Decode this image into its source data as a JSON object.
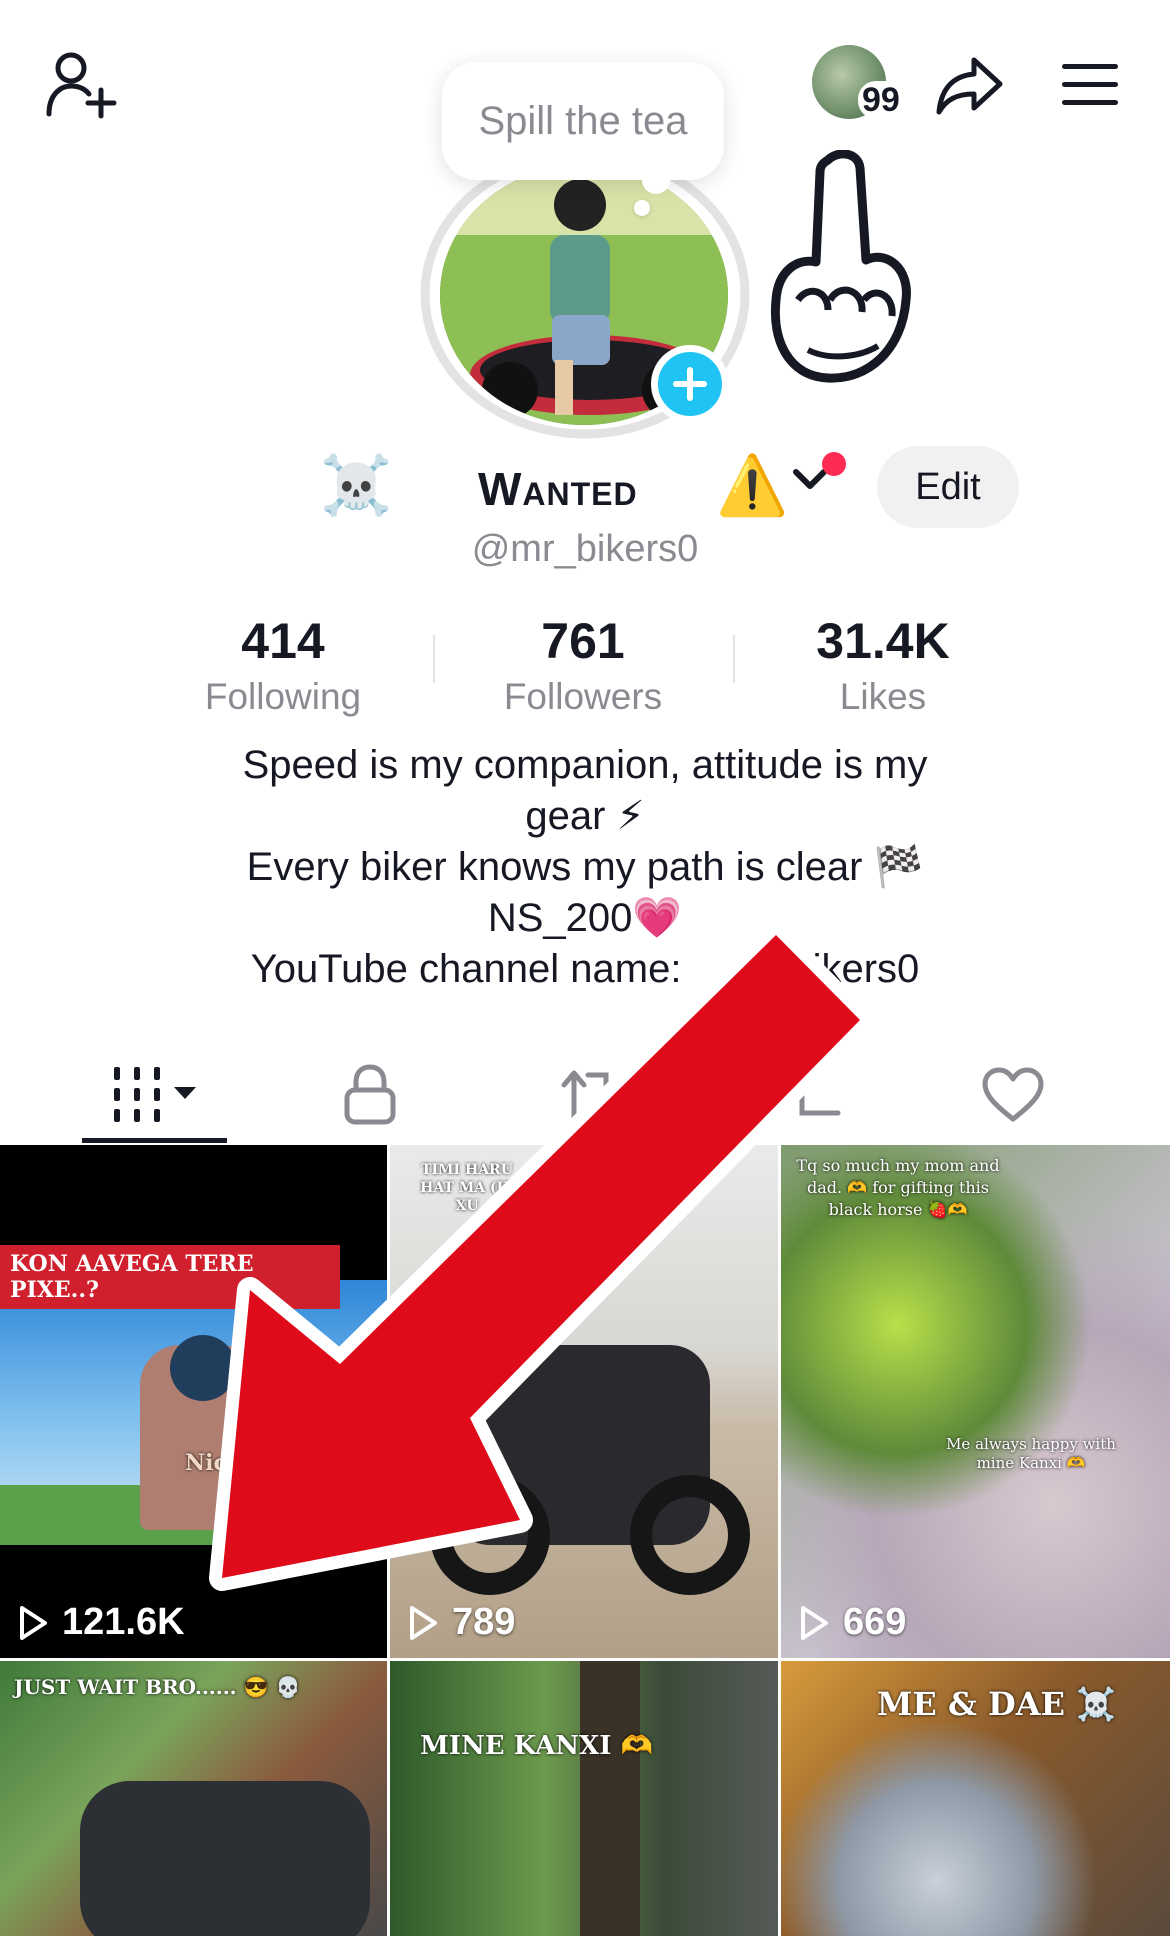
{
  "header": {
    "add_friend_icon": "person-plus-icon",
    "share_icon": "share-arrow-icon",
    "menu_icon": "hamburger-menu-icon",
    "notification_count": "99"
  },
  "bubble": {
    "text": "Spill the tea"
  },
  "profile": {
    "skull_emoji": "☠️",
    "name": "Wanted",
    "warning_emoji": "⚠️",
    "handle": "@mr_bikers0",
    "edit_label": "Edit"
  },
  "stats": [
    {
      "value": "414",
      "label": "Following"
    },
    {
      "value": "761",
      "label": "Followers"
    },
    {
      "value": "31.4K",
      "label": "Likes"
    }
  ],
  "bio": {
    "line1": "Speed is my companion, attitude is my",
    "line2": "gear ⚡",
    "line3": "Every biker knows my path is clear 🏁",
    "line4": "NS_200💗",
    "line5_start": "YouTube channel name: ",
    "line5_end": "ikers0"
  },
  "tabs": [
    "videos-grid",
    "private",
    "reposts",
    "tagged",
    "liked"
  ],
  "videos": [
    {
      "caption": "KON AAVEGA TERE PIXE..?",
      "views": "121.6K",
      "overlay": "Nice"
    },
    {
      "caption": "TIMI HARU HAT MA (IE XU",
      "views": "789"
    },
    {
      "caption": "Tq so much my mom and dad. 🫶 for gifting this black horse 🍓🫶",
      "caption2": "Me always happy with mine Kanxi 🫶",
      "views": "669"
    },
    {
      "caption": "JUST WAIT BRO...... 😎 💀"
    },
    {
      "caption": "MINE KANXI 🫶"
    },
    {
      "caption": "ME & DAE ☠️"
    }
  ],
  "colors": {
    "accent_blue": "#20c4f4",
    "red_dot": "#fe2c55",
    "arrow_red": "#e00b1a"
  }
}
